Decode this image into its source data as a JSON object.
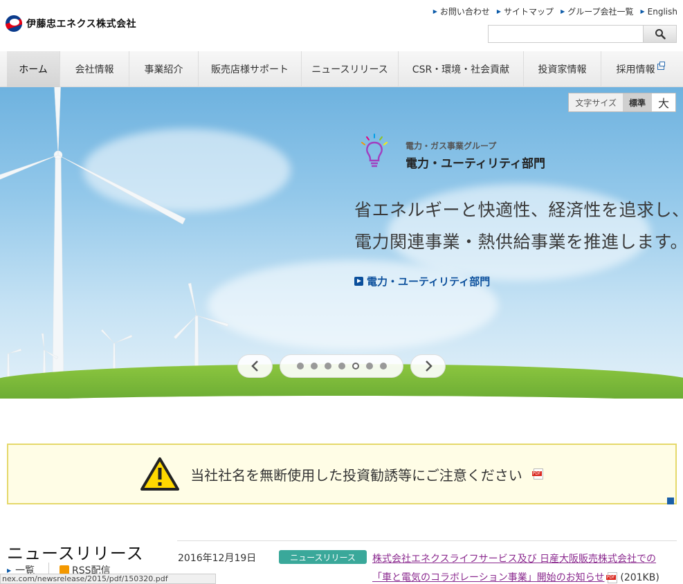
{
  "header": {
    "logo_text": "伊藤忠エネクス株式会社",
    "util_links": [
      "お問い合わせ",
      "サイトマップ",
      "グループ会社一覧",
      "English"
    ],
    "search": {
      "value": "",
      "placeholder": ""
    }
  },
  "nav": {
    "items": [
      "ホーム",
      "会社情報",
      "事業紹介",
      "販売店様サポート",
      "ニュースリリース",
      "CSR・環境・社会貢献",
      "投資家情報",
      "採用情報"
    ]
  },
  "font_size": {
    "label": "文字サイズ",
    "standard": "標準",
    "large": "大"
  },
  "hero": {
    "group_label": "電力・ガス事業グループ",
    "division": "電力・ユーティリティ部門",
    "line1": "省エネルギーと快適性、経済性を追求し、",
    "line2": "電力関連事業・熱供給事業を推進します。",
    "link": "電力・ユーティリティ部門",
    "slider": {
      "total": 7,
      "active_index": 4
    }
  },
  "notice": {
    "text": "当社社名を無断使用した投資勧誘等にご注意ください"
  },
  "news": {
    "title": "ニュースリリース",
    "list_link": "一覧",
    "rss": "RSS配信",
    "items": [
      {
        "date": "2016年12月19日",
        "category": "ニュースリリース",
        "title_line1": "株式会社エネクスライフサービス及び 日産大阪販売株式会社での",
        "title_line2": "「車と電気のコラボレーション事業」開始のお知らせ",
        "size": "(201KB)"
      }
    ]
  },
  "status_bar": {
    "url": "nex.com/newsrelease/2015/pdf/150320.pdf"
  },
  "colors": {
    "brand_blue": "#0b3b8c",
    "brand_red": "#e60012",
    "badge_teal": "#3aa89a",
    "link_purple": "#8b2a8f"
  }
}
